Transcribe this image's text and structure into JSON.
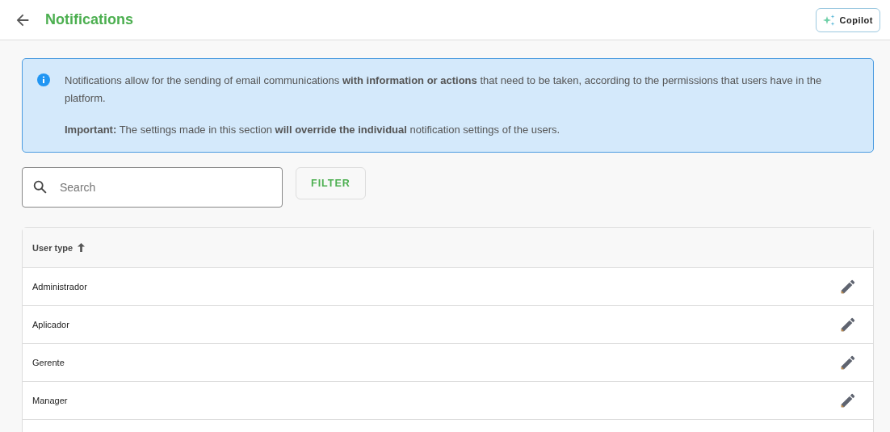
{
  "header": {
    "title": "Notifications",
    "copilot_button": "Copilot"
  },
  "info": {
    "paragraphs": [
      "Notifications allow for the sending of email communications **with information or actions** that need to be taken, according to the permissions that users have in the platform.",
      "**Important:** The settings made in this section **will override the individual** notification settings of the users."
    ]
  },
  "search": {
    "placeholder": "Search"
  },
  "filter_button": "FILTER",
  "table": {
    "columns": [
      {
        "label": "User type",
        "sorted": true
      }
    ],
    "rows": [
      {
        "user_type": "Administrador"
      },
      {
        "user_type": "Aplicador"
      },
      {
        "user_type": "Gerente"
      },
      {
        "user_type": "Manager"
      }
    ]
  }
}
